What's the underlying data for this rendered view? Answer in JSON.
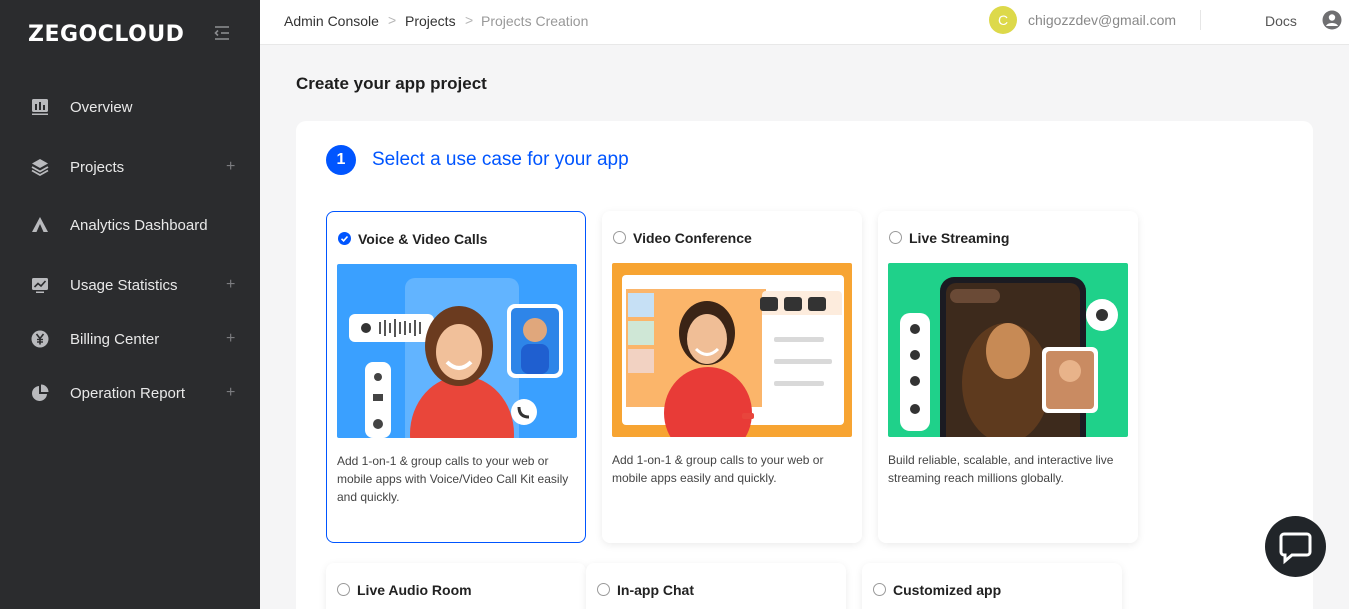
{
  "brand": {
    "logo_text": "ZEGOCLOUD"
  },
  "sidebar": {
    "items": [
      {
        "label": "Overview",
        "icon": "overview-icon",
        "expandable": false
      },
      {
        "label": "Projects",
        "icon": "layers-icon",
        "expandable": true,
        "plus": "+"
      },
      {
        "label": "Analytics Dashboard",
        "icon": "analytics-icon",
        "expandable": false
      },
      {
        "label": "Usage Statistics",
        "icon": "usage-chart-icon",
        "expandable": true,
        "plus": "+"
      },
      {
        "label": "Billing Center",
        "icon": "yen-coin-icon",
        "expandable": true,
        "plus": "+"
      },
      {
        "label": "Operation Report",
        "icon": "pie-chart-icon",
        "expandable": true,
        "plus": "+"
      }
    ]
  },
  "topbar": {
    "breadcrumb": [
      "Admin Console",
      "Projects",
      "Projects Creation"
    ],
    "separator": ">",
    "avatar_initial": "C",
    "email": "chigozzdev@gmail.com",
    "docs_label": "Docs"
  },
  "main": {
    "page_title": "Create your app project",
    "step": {
      "number": "1",
      "title": "Select a use case for your app"
    },
    "use_cases": [
      {
        "title": "Voice & Video Calls",
        "selected": true,
        "description": "Add 1-on-1 & group calls to your web or mobile apps with Voice/Video Call Kit easily and quickly.",
        "image_bg": "#3aa0ff"
      },
      {
        "title": "Video Conference",
        "selected": false,
        "description": "Add 1-on-1 & group calls to your web or mobile apps easily and quickly.",
        "image_bg": "#f7a432"
      },
      {
        "title": "Live Streaming",
        "selected": false,
        "description": "Build reliable, scalable, and interactive live streaming reach millions globally.",
        "image_bg": "#1fd18a"
      },
      {
        "title": "Live Audio Room",
        "selected": false
      },
      {
        "title": "In-app Chat",
        "selected": false
      },
      {
        "title": "Customized app",
        "selected": false
      }
    ]
  },
  "colors": {
    "accent": "#0055ff",
    "sidebar_bg": "#2b2c2e",
    "avatar_bg": "#ddd94a",
    "chat_button": "#212529"
  }
}
